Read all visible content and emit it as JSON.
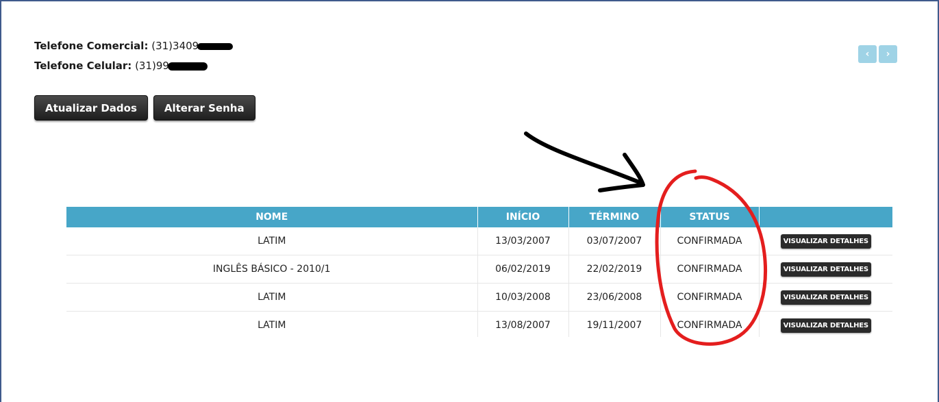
{
  "contact": {
    "comercial_label": "Telefone Comercial:",
    "comercial_value": "(31)3409",
    "celular_label": "Telefone Celular:",
    "celular_value": "(31)99"
  },
  "pager": {
    "prev_icon": "chevron-left-icon",
    "next_icon": "chevron-right-icon",
    "prev_glyph": "‹",
    "next_glyph": "›"
  },
  "actions": {
    "update_label": "Atualizar Dados",
    "password_label": "Alterar Senha"
  },
  "table": {
    "headers": [
      "NOME",
      "INÍCIO",
      "TÉRMINO",
      "STATUS",
      ""
    ],
    "rows": [
      {
        "nome": "LATIM",
        "inicio": "13/03/2007",
        "termino": "03/07/2007",
        "status": "CONFIRMADA",
        "action": "VISUALIZAR DETALHES"
      },
      {
        "nome": "INGLÊS BÁSICO - 2010/1",
        "inicio": "06/02/2019",
        "termino": "22/02/2019",
        "status": "CONFIRMADA",
        "action": "VISUALIZAR DETALHES"
      },
      {
        "nome": "LATIM",
        "inicio": "10/03/2008",
        "termino": "23/06/2008",
        "status": "CONFIRMADA",
        "action": "VISUALIZAR DETALHES"
      },
      {
        "nome": "LATIM",
        "inicio": "13/08/2007",
        "termino": "19/11/2007",
        "status": "CONFIRMADA",
        "action": "VISUALIZAR DETALHES"
      }
    ]
  },
  "colors": {
    "header_bg": "#47a6c8",
    "pager_bg": "#9fd3e6",
    "annotation_circle": "#e41e1e",
    "annotation_arrow": "#000000"
  }
}
